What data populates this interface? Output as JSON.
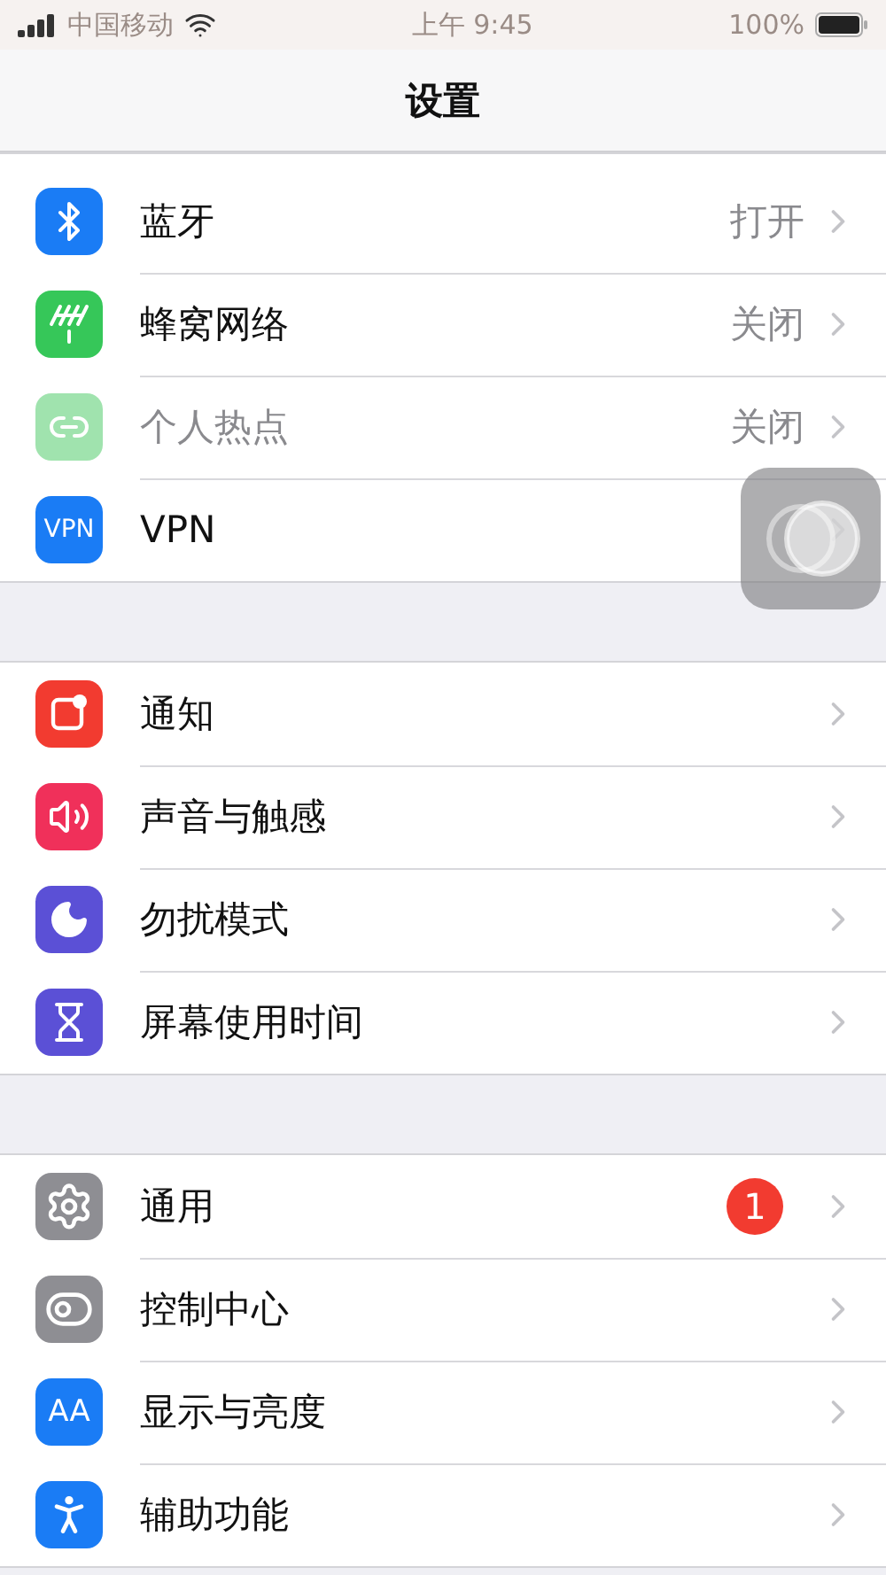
{
  "status_bar": {
    "carrier": "中国移动",
    "time": "上午 9:45",
    "battery": "100%"
  },
  "nav": {
    "title": "设置"
  },
  "groups": [
    {
      "items": [
        {
          "label": "蓝牙",
          "value": "打开",
          "color": "#1a7cf5",
          "disabled": false
        },
        {
          "label": "蜂窝网络",
          "value": "关闭",
          "color": "#36c759",
          "disabled": false
        },
        {
          "label": "个人热点",
          "value": "关闭",
          "color": "#a0e3ae",
          "disabled": true
        },
        {
          "label": "VPN",
          "icon_text": "VPN",
          "color": "#1a7cf5",
          "disabled": false
        }
      ]
    },
    {
      "items": [
        {
          "label": "通知",
          "color": "#f23b30",
          "disabled": false
        },
        {
          "label": "声音与触感",
          "color": "#f0305a",
          "disabled": false
        },
        {
          "label": "勿扰模式",
          "color": "#5b50d6",
          "disabled": false
        },
        {
          "label": "屏幕使用时间",
          "color": "#5b50d6",
          "disabled": false
        }
      ]
    },
    {
      "items": [
        {
          "label": "通用",
          "badge": "1",
          "color": "#8e8e93",
          "disabled": false
        },
        {
          "label": "控制中心",
          "color": "#8e8e93",
          "disabled": false
        },
        {
          "label": "显示与亮度",
          "icon_text": "AA",
          "color": "#1a7cf5",
          "disabled": false
        },
        {
          "label": "辅助功能",
          "color": "#1a7cf5",
          "disabled": false
        }
      ]
    }
  ]
}
